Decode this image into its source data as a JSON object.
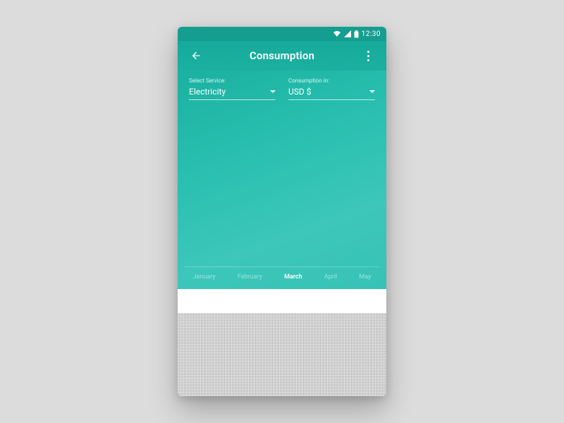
{
  "status": {
    "time": "12:30"
  },
  "header": {
    "title": "Consumption"
  },
  "selectors": {
    "service": {
      "label": "Select Service:",
      "value": "Electricity"
    },
    "unit": {
      "label": "Consumption in:",
      "value": "USD $"
    }
  },
  "months": {
    "items": [
      "January",
      "February",
      "March",
      "April",
      "May"
    ],
    "active": "March"
  }
}
